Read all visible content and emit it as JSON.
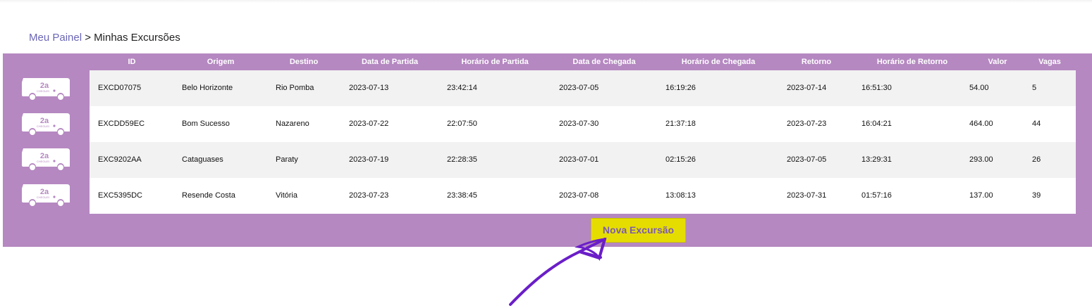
{
  "breadcrumb": {
    "home_link": "Meu Painel",
    "separator": " > ",
    "current": "Minhas Excursões"
  },
  "table": {
    "columns": [
      "ID",
      "Origem",
      "Destino",
      "Data de Partida",
      "Horário de Partida",
      "Data de Chegada",
      "Horário de Chegada",
      "Retorno",
      "Horário de Retorno",
      "Valor",
      "Vagas"
    ],
    "rows": [
      [
        "EXCD07075",
        "Belo Horizonte",
        "Rio Pomba",
        "2023-07-13",
        "23:42:14",
        "2023-07-05",
        "16:19:26",
        "2023-07-14",
        "16:51:30",
        "54.00",
        "5"
      ],
      [
        "EXCDD59EC",
        "Bom Sucesso",
        "Nazareno",
        "2023-07-22",
        "22:07:50",
        "2023-07-30",
        "21:37:18",
        "2023-07-23",
        "16:04:21",
        "464.00",
        "44"
      ],
      [
        "EXC9202AA",
        "Cataguases",
        "Paraty",
        "2023-07-19",
        "22:28:35",
        "2023-07-01",
        "02:15:26",
        "2023-07-05",
        "13:29:31",
        "293.00",
        "26"
      ],
      [
        "EXC5395DC",
        "Resende Costa",
        "Vitória",
        "2023-07-23",
        "23:38:45",
        "2023-07-08",
        "13:08:13",
        "2023-07-31",
        "01:57:16",
        "137.00",
        "39"
      ]
    ]
  },
  "bus_icon": {
    "name": "bus-icon",
    "logo_text": "CHEGUEI"
  },
  "new_button": {
    "label": "Nova Excursão"
  },
  "colors": {
    "panel": "#b588c1",
    "button": "#e6dd00",
    "button_text": "#7a5ab3",
    "link": "#6a66b6",
    "annotation_arrow": "#6a1ec8"
  }
}
